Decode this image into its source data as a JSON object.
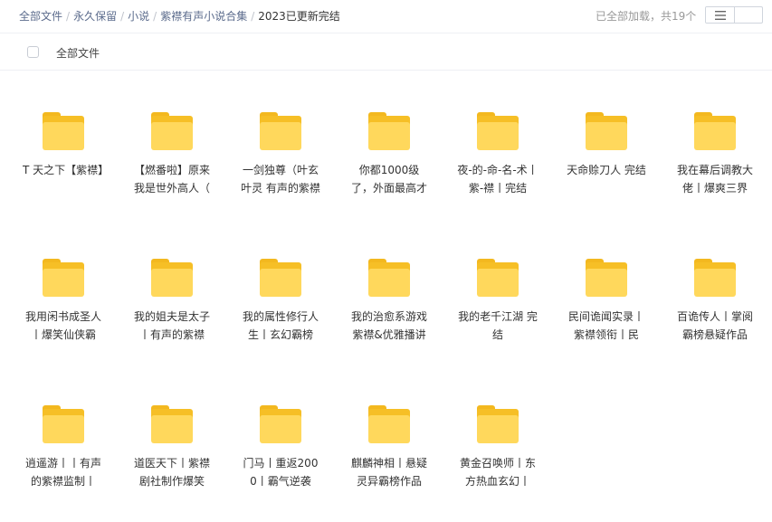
{
  "breadcrumb": {
    "items": [
      "全部文件",
      "永久保留",
      "小说",
      "紫襟有声小说合集"
    ],
    "current": "2023已更新完结",
    "separator": "/"
  },
  "status_text": "已全部加载，共19个",
  "view_toggle": {
    "list_icon": "list-icon",
    "grid_icon": "grid-icon",
    "active": "grid"
  },
  "header": {
    "all_files_label": "全部文件"
  },
  "folders": [
    "T 天之下【紫襟】",
    "【燃番啦】原来我是世外高人（",
    "一剑独尊（叶玄叶灵 有声的紫襟",
    "你都1000级了，外面最高才",
    "夜-的-命-名-术丨紫-襟丨完结",
    "天命赊刀人 完结",
    "我在幕后调教大佬丨爆爽三界",
    "我用闲书成圣人丨爆笑仙侠霸",
    "我的姐夫是太子丨有声的紫襟",
    "我的属性修行人生丨玄幻霸榜",
    "我的治愈系游戏紫襟&优雅播讲",
    "我的老千江湖 完结",
    "民间诡闻实录丨紫襟领衔丨民",
    "百诡传人丨掌阅霸榜悬疑作品",
    "逍遥游丨丨有声的紫襟监制丨",
    "道医天下丨紫襟剧社制作爆笑",
    "门马丨重返2000丨霸气逆袭",
    "麒麟神相丨悬疑灵异霸榜作品",
    "黄金召唤师丨东方热血玄幻丨"
  ],
  "colors": {
    "folder": "#ffd85c",
    "folder_dark": "#f6bf26",
    "toggle_active": "#5a5f6b"
  }
}
